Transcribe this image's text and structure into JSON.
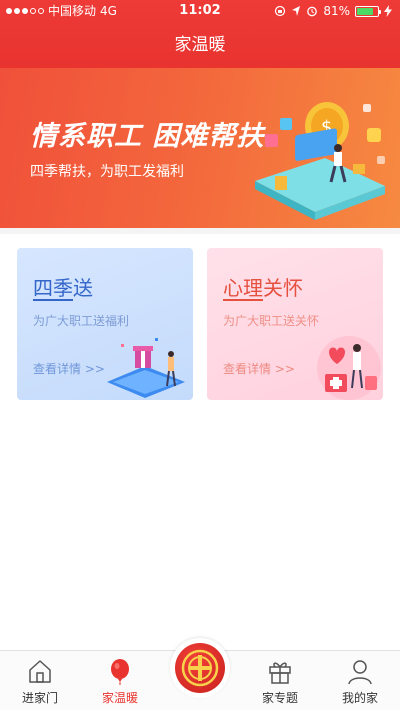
{
  "status_bar": {
    "carrier": "中国移动",
    "network": "4G",
    "time": "11:02",
    "battery_percent": "81%",
    "battery_level": 0.81,
    "battery_color": "#4cd964"
  },
  "header": {
    "title": "家温暖",
    "color": "#e8332f"
  },
  "banner": {
    "headline": "情系职工 困难帮扶",
    "subtitle": "四季帮扶，为职工发福利"
  },
  "cards": [
    {
      "title": "四季送",
      "description": "为广大职工送福利",
      "link": "查看详情 >>"
    },
    {
      "title": "心理关怀",
      "description": "为广大职工送关怀",
      "link": "查看详情 >>"
    }
  ],
  "tabbar": {
    "items": [
      {
        "label": "进家门",
        "icon": "home-icon"
      },
      {
        "label": "家温暖",
        "icon": "balloon-icon",
        "active": true
      },
      {
        "label": "",
        "icon": "union-emblem-icon"
      },
      {
        "label": "家专题",
        "icon": "gift-icon"
      },
      {
        "label": "我的家",
        "icon": "user-icon"
      }
    ],
    "active_color": "#e8332f"
  }
}
